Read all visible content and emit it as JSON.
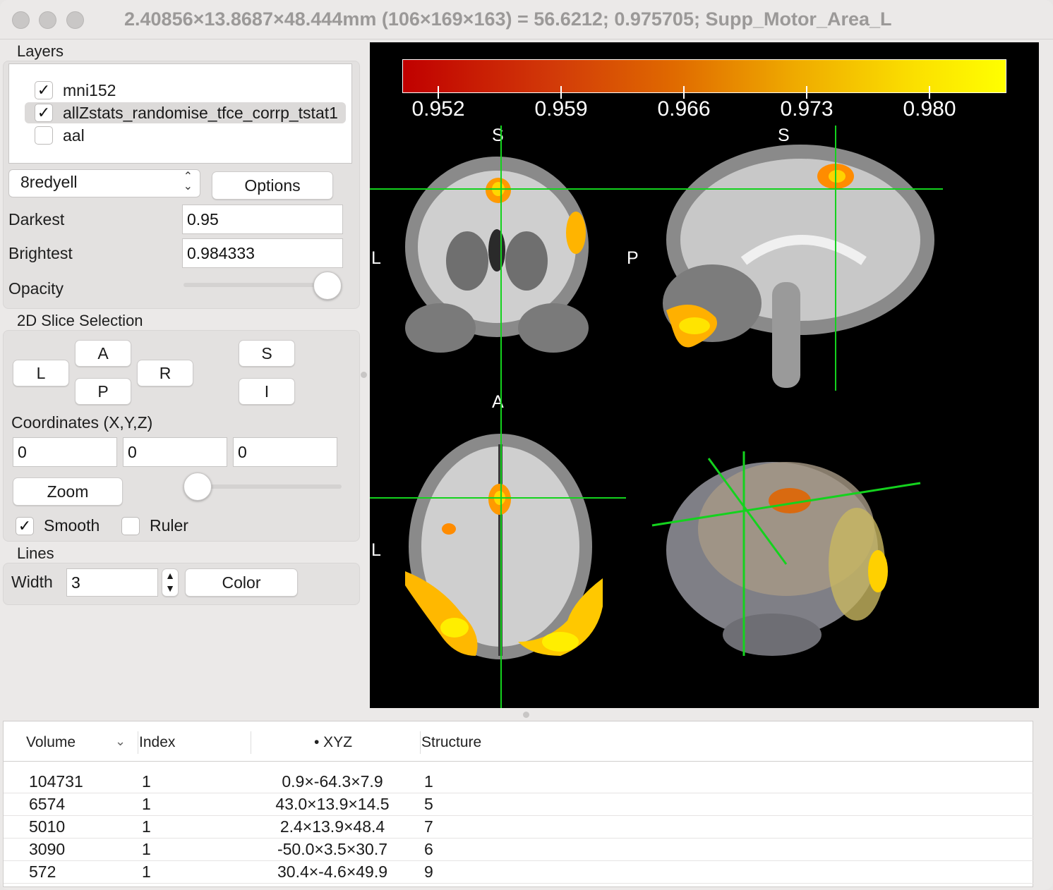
{
  "window": {
    "title": "2.40856×13.8687×48.444mm (106×169×163) =  56.6212;  0.975705; Supp_Motor_Area_L"
  },
  "layers": {
    "label": "Layers",
    "items": [
      {
        "name": "mni152",
        "checked": true
      },
      {
        "name": "allZstats_randomise_tfce_corrp_tstat1",
        "checked": true
      },
      {
        "name": "aal",
        "checked": false
      }
    ]
  },
  "colormap": {
    "selected": "8redyell",
    "options_label": "Options",
    "darkest_label": "Darkest",
    "darkest_value": "0.95",
    "brightest_label": "Brightest",
    "brightest_value": "0.984333",
    "opacity_label": "Opacity",
    "opacity": 1.0
  },
  "slice_selection": {
    "label": "2D Slice Selection",
    "buttons": {
      "L": "L",
      "A": "A",
      "P": "P",
      "R": "R",
      "S": "S",
      "I": "I"
    },
    "coords_label": "Coordinates (X,Y,Z)",
    "x": "0",
    "y": "0",
    "z": "0",
    "zoom_label": "Zoom",
    "zoom_level": 0.0,
    "smooth_label": "Smooth",
    "smooth_checked": true,
    "ruler_label": "Ruler",
    "ruler_checked": false
  },
  "lines": {
    "label": "Lines",
    "width_label": "Width",
    "width_value": "3",
    "color_label": "Color",
    "crosshair_color": "#14d21e"
  },
  "viewer": {
    "colorbar_labels": [
      "0.952",
      "0.959",
      "0.966",
      "0.973",
      "0.980"
    ],
    "orientation": {
      "coronal_top": "S",
      "coronal_left": "L",
      "sagittal_top": "S",
      "sagittal_left": "P",
      "axial_top": "A",
      "axial_left": "L"
    }
  },
  "table": {
    "columns": [
      "Volume",
      "Index",
      "• XYZ",
      "Structure"
    ],
    "rows": [
      {
        "volume": "104731",
        "index": "1",
        "xyz": "0.9×-64.3×7.9",
        "structure": "1"
      },
      {
        "volume": "6574",
        "index": "1",
        "xyz": "43.0×13.9×14.5",
        "structure": "5"
      },
      {
        "volume": "5010",
        "index": "1",
        "xyz": "2.4×13.9×48.4",
        "structure": "7"
      },
      {
        "volume": "3090",
        "index": "1",
        "xyz": "-50.0×3.5×30.7",
        "structure": "6"
      },
      {
        "volume": "572",
        "index": "1",
        "xyz": "30.4×-4.6×49.9",
        "structure": "9"
      }
    ]
  }
}
